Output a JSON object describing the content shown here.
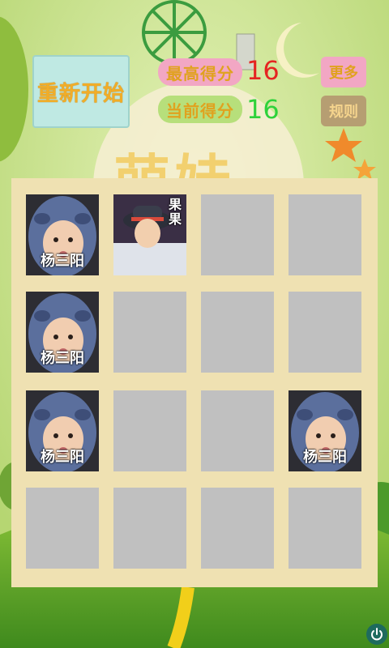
{
  "buttons": {
    "restart": "重新开始",
    "more": "更多",
    "rules": "规则"
  },
  "scores": {
    "best_label": "最高得分",
    "best_value": "16",
    "current_label": "当前得分",
    "current_value": "16"
  },
  "title": "萌娃",
  "board": {
    "cells": [
      {
        "filled": true,
        "label": "杨三阳",
        "style": "blue-hood"
      },
      {
        "filled": true,
        "label": "果果",
        "style": "hat-kid"
      },
      {
        "filled": false,
        "label": "",
        "style": ""
      },
      {
        "filled": false,
        "label": "",
        "style": ""
      },
      {
        "filled": true,
        "label": "杨三阳",
        "style": "blue-hood"
      },
      {
        "filled": false,
        "label": "",
        "style": ""
      },
      {
        "filled": false,
        "label": "",
        "style": ""
      },
      {
        "filled": false,
        "label": "",
        "style": ""
      },
      {
        "filled": true,
        "label": "杨三阳",
        "style": "blue-hood"
      },
      {
        "filled": false,
        "label": "",
        "style": ""
      },
      {
        "filled": false,
        "label": "",
        "style": ""
      },
      {
        "filled": true,
        "label": "杨三阳",
        "style": "blue-hood"
      },
      {
        "filled": false,
        "label": "",
        "style": ""
      },
      {
        "filled": false,
        "label": "",
        "style": ""
      },
      {
        "filled": false,
        "label": "",
        "style": ""
      },
      {
        "filled": false,
        "label": "",
        "style": ""
      }
    ]
  },
  "colors": {
    "board": "#efe1b2",
    "empty_cell": "#c0c0c0",
    "best_value": "#e52521",
    "current_value": "#2fd23b"
  },
  "icons": {
    "power": "power-icon"
  }
}
